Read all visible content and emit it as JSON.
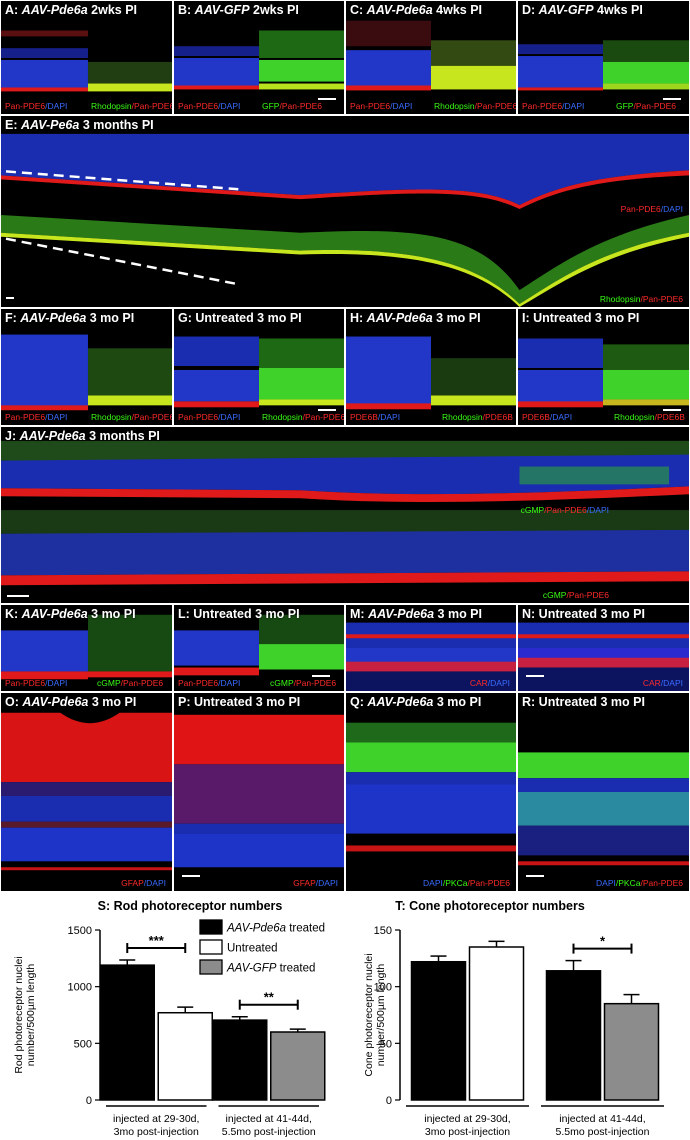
{
  "colors": {
    "dapi_blue": "#1e33c8",
    "red_stain": "#e01a1a",
    "green_stain": "#3fd22a",
    "yellow_merge": "#c8e61e",
    "bar_treated": "#000000",
    "bar_untreated": "#ffffff",
    "bar_gfp": "#8c8c8c"
  },
  "panels": {
    "A": {
      "prefix": "A: ",
      "italic": "AAV-Pde6a",
      "suffix": " 2wks PI",
      "left_stain": [
        "Pan-PDE6",
        "/",
        "DAPI"
      ],
      "right_stain": [
        "Rhodopsin",
        "/",
        "Pan-PDE6"
      ]
    },
    "B": {
      "prefix": "B: ",
      "italic": "AAV-GFP",
      "suffix": " 2wks PI",
      "left_stain": [
        "Pan-PDE6",
        "/",
        "DAPI"
      ],
      "right_stain": [
        "GFP",
        "/",
        "Pan-PDE6"
      ]
    },
    "C": {
      "prefix": "C: ",
      "italic": "AAV-Pde6a",
      "suffix": " 4wks PI",
      "left_stain": [
        "Pan-PDE6",
        "/",
        "DAPI"
      ],
      "right_stain": [
        "Rhodopsin",
        "/",
        "Pan-PDE6"
      ]
    },
    "D": {
      "prefix": "D: ",
      "italic": "AAV-GFP",
      "suffix": " 4wks PI",
      "left_stain": [
        "Pan-PDE6",
        "/",
        "DAPI"
      ],
      "right_stain": [
        "GFP",
        "/",
        "Pan-PDE6"
      ]
    },
    "E": {
      "prefix": "E: ",
      "italic": "AAV-Pe6a",
      "suffix": " 3 months PI",
      "stain_top": [
        "Pan-PDE6",
        "/",
        "DAPI"
      ],
      "stain_bottom": [
        "Rhodopsin",
        "/",
        "Pan-PDE6"
      ]
    },
    "F": {
      "prefix": "F: ",
      "italic": "AAV-Pde6a",
      "suffix": " 3 mo PI",
      "left_stain": [
        "Pan-PDE6",
        "/",
        "DAPI"
      ],
      "right_stain": [
        "Rhodopsin",
        "/",
        "Pan-PDE6"
      ]
    },
    "G": {
      "prefix": "G: ",
      "italic": "",
      "suffix": "Untreated 3 mo PI",
      "left_stain": [
        "Pan-PDE6",
        "/",
        "DAPI"
      ],
      "right_stain": [
        "Rhodopsin",
        "/",
        "Pan-PDE6"
      ]
    },
    "H": {
      "prefix": "H: ",
      "italic": "AAV-Pde6a",
      "suffix": " 3 mo PI",
      "left_stain": [
        "PDE6B",
        "/",
        "DAPI"
      ],
      "right_stain": [
        "Rhodopsin",
        "/",
        "PDE6B"
      ]
    },
    "I": {
      "prefix": "I: ",
      "italic": "",
      "suffix": "Untreated 3 mo PI",
      "left_stain": [
        "PDE6B",
        "/",
        "DAPI"
      ],
      "right_stain": [
        "Rhodopsin",
        "/",
        "PDE6B"
      ]
    },
    "J": {
      "prefix": "J: ",
      "italic": "AAV-Pde6a",
      "suffix": " 3 months PI",
      "stain_top": [
        "cGMP",
        "/",
        "Pan-PDE6",
        "/",
        "DAPI"
      ],
      "stain_bottom": [
        "cGMP",
        "/",
        "Pan-PDE6"
      ]
    },
    "K": {
      "prefix": "K: ",
      "italic": "AAV-Pde6a",
      "suffix": " 3 mo PI",
      "left_stain": [
        "Pan-PDE6",
        "/",
        "DAPI"
      ],
      "right_stain": [
        "cGMP",
        "/",
        "Pan-PDE6"
      ]
    },
    "L": {
      "prefix": "L: ",
      "italic": "",
      "suffix": "Untreated 3 mo PI",
      "left_stain": [
        "Pan-PDE6",
        "/",
        "DAPI"
      ],
      "right_stain": [
        "cGMP",
        "/",
        "Pan-PDE6"
      ]
    },
    "M": {
      "prefix": "M: ",
      "italic": "AAV-Pde6a",
      "suffix": " 3 mo PI",
      "stain": [
        "CAR",
        "/",
        "DAPI"
      ]
    },
    "N": {
      "prefix": "N: ",
      "italic": "",
      "suffix": "Untreated 3 mo PI",
      "stain": [
        "CAR",
        "/",
        "DAPI"
      ]
    },
    "O": {
      "prefix": "O: ",
      "italic": "AAV-Pde6a",
      "suffix": " 3 mo PI",
      "stain": [
        "GFAP",
        "/",
        "DAPI"
      ]
    },
    "P": {
      "prefix": "P: ",
      "italic": "",
      "suffix": "Untreated 3 mo PI",
      "stain": [
        "GFAP",
        "/",
        "DAPI"
      ]
    },
    "Q": {
      "prefix": "Q: ",
      "italic": "AAV-Pde6a",
      "suffix": " 3 mo PI",
      "stain": [
        "DAPI",
        "/",
        "PKCa",
        "/",
        "Pan-PDE6"
      ]
    },
    "R": {
      "prefix": "R: ",
      "italic": "",
      "suffix": "Untreated 3 mo PI",
      "stain": [
        "DAPI",
        "/",
        "PKCa",
        "/",
        "Pan-PDE6"
      ]
    }
  },
  "legend": {
    "treated_italic": "AAV-Pde6a",
    "treated_suffix": " treated",
    "untreated": "Untreated",
    "gfp_italic": "AAV-GFP",
    "gfp_suffix": " treated"
  },
  "chart_data": [
    {
      "type": "bar",
      "title": "S: Rod photoreceptor numbers",
      "ylabel_line1": "Rod photoreceptor nuclei",
      "ylabel_line2": "number/500µm length",
      "ylim": [
        0,
        1500
      ],
      "yticks": [
        "0",
        "500",
        "1000",
        "1500"
      ],
      "groups": [
        {
          "label_line1": "injected at 29-30d,",
          "label_line2": "3mo post-injection",
          "bars": [
            {
              "series": "AAV-Pde6a treated",
              "value": 1190,
              "error": 45
            },
            {
              "series": "Untreated",
              "value": 770,
              "error": 50
            }
          ],
          "significance": "***"
        },
        {
          "label_line1": "injected at 41-44d,",
          "label_line2": "5.5mo post-injection",
          "bars": [
            {
              "series": "AAV-Pde6a treated",
              "value": 705,
              "error": 30
            },
            {
              "series": "AAV-GFP treated",
              "value": 600,
              "error": 25
            }
          ],
          "significance": "**"
        }
      ]
    },
    {
      "type": "bar",
      "title": "T: Cone photoreceptor numbers",
      "ylabel_line1": "Cone photoreceptor nuclei",
      "ylabel_line2": "number/500µm length",
      "ylim": [
        0,
        150
      ],
      "yticks": [
        "0",
        "50",
        "100",
        "150"
      ],
      "groups": [
        {
          "label_line1": "injected at 29-30d,",
          "label_line2": "3mo post-injection",
          "bars": [
            {
              "series": "AAV-Pde6a treated",
              "value": 122,
              "error": 5
            },
            {
              "series": "Untreated",
              "value": 135,
              "error": 5
            }
          ],
          "significance": ""
        },
        {
          "label_line1": "injected at 41-44d,",
          "label_line2": "5.5mo post-injection",
          "bars": [
            {
              "series": "AAV-Pde6a treated",
              "value": 114,
              "error": 9
            },
            {
              "series": "AAV-GFP treated",
              "value": 85,
              "error": 8
            }
          ],
          "significance": "*"
        }
      ]
    }
  ]
}
